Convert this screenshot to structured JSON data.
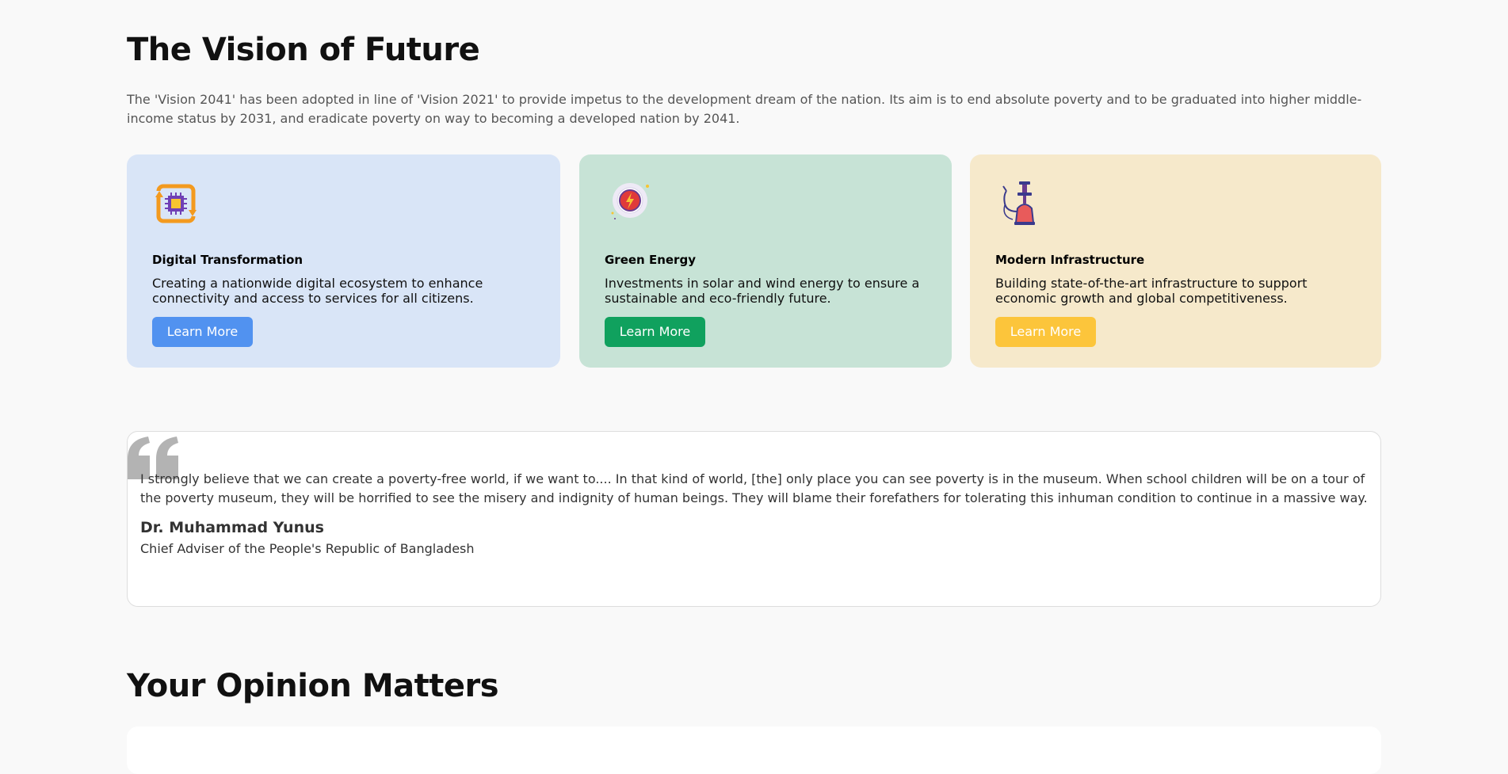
{
  "vision": {
    "title": "The Vision of Future",
    "description": "The 'Vision 2041' has been adopted in line of 'Vision 2021' to provide impetus to the development dream of the nation. Its aim is to end absolute poverty and to be graduated into higher middle-income status by 2031, and eradicate poverty on way to becoming a developed nation by 2041."
  },
  "cards": [
    {
      "title": "Digital Transformation",
      "description": "Creating a nationwide digital ecosystem to enhance connectivity and access to services for all citizens.",
      "button_label": "Learn More",
      "icon": "chip-cycle-icon",
      "bg_color": "#d9e5f7",
      "button_color": "#5192f0"
    },
    {
      "title": "Green Energy",
      "description": "Investments in solar and wind energy to ensure a sustainable and eco-friendly future.",
      "button_label": "Learn More",
      "icon": "energy-bolt-icon",
      "bg_color": "#c7e3d6",
      "button_color": "#10a15e"
    },
    {
      "title": "Modern Infrastructure",
      "description": "Building state-of-the-art infrastructure to support economic growth and global competitiveness.",
      "button_label": "Learn More",
      "icon": "hookah-icon",
      "bg_color": "#f6e9cb",
      "button_color": "#fcc53b"
    }
  ],
  "quote": {
    "text": "I strongly believe that we can create a poverty-free world, if we want to.... In that kind of world, [the] only place you can see poverty is in the museum. When school children will be on a tour of the poverty museum, they will be horrified to see the misery and indignity of human beings. They will blame their forefathers for tolerating this inhuman condition to continue in a massive way.",
    "author": "Dr. Muhammad Yunus",
    "role": "Chief Adviser of the People's Republic of Bangladesh"
  },
  "opinion": {
    "title": "Your Opinion Matters"
  }
}
